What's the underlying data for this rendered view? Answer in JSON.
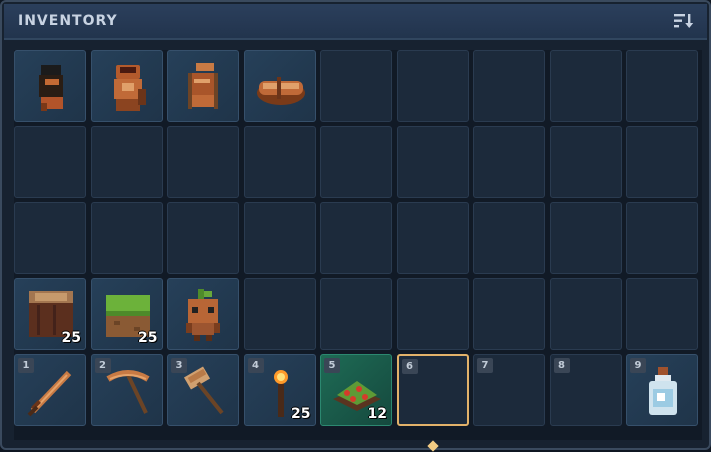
{
  "header": {
    "title": "INVENTORY",
    "sort_icon": "sort-icon"
  },
  "slots": [
    {
      "item": "backpack-dark",
      "count": ""
    },
    {
      "item": "backpack-copper",
      "count": ""
    },
    {
      "item": "backpack-frame",
      "count": ""
    },
    {
      "item": "bedroll",
      "count": ""
    },
    {
      "item": "",
      "count": ""
    },
    {
      "item": "",
      "count": ""
    },
    {
      "item": "",
      "count": ""
    },
    {
      "item": "",
      "count": ""
    },
    {
      "item": "",
      "count": ""
    },
    {
      "item": "",
      "count": ""
    },
    {
      "item": "",
      "count": ""
    },
    {
      "item": "",
      "count": ""
    },
    {
      "item": "",
      "count": ""
    },
    {
      "item": "",
      "count": ""
    },
    {
      "item": "",
      "count": ""
    },
    {
      "item": "",
      "count": ""
    },
    {
      "item": "",
      "count": ""
    },
    {
      "item": "",
      "count": ""
    },
    {
      "item": "",
      "count": ""
    },
    {
      "item": "",
      "count": ""
    },
    {
      "item": "",
      "count": ""
    },
    {
      "item": "",
      "count": ""
    },
    {
      "item": "",
      "count": ""
    },
    {
      "item": "",
      "count": ""
    },
    {
      "item": "",
      "count": ""
    },
    {
      "item": "",
      "count": ""
    },
    {
      "item": "",
      "count": ""
    },
    {
      "item": "wood-log",
      "count": "25"
    },
    {
      "item": "grass-block",
      "count": "25"
    },
    {
      "item": "sapling-creature",
      "count": ""
    },
    {
      "item": "",
      "count": ""
    },
    {
      "item": "",
      "count": ""
    },
    {
      "item": "",
      "count": ""
    },
    {
      "item": "",
      "count": ""
    },
    {
      "item": "",
      "count": ""
    },
    {
      "item": "",
      "count": ""
    }
  ],
  "hotbar": [
    {
      "key": "1",
      "item": "copper-sword",
      "count": ""
    },
    {
      "key": "2",
      "item": "copper-pickaxe",
      "count": ""
    },
    {
      "key": "3",
      "item": "copper-hammer",
      "count": ""
    },
    {
      "key": "4",
      "item": "torch",
      "count": "25"
    },
    {
      "key": "5",
      "item": "berry-bush",
      "count": "12"
    },
    {
      "key": "6",
      "item": "",
      "count": ""
    },
    {
      "key": "7",
      "item": "",
      "count": ""
    },
    {
      "key": "8",
      "item": "",
      "count": ""
    },
    {
      "key": "9",
      "item": "potion-bottle",
      "count": ""
    }
  ],
  "hotbar_selected_key": "6",
  "colors": {
    "selected_border": "#e2b26a",
    "highlight_slot": "#1e6b55",
    "panel": "#172230"
  }
}
